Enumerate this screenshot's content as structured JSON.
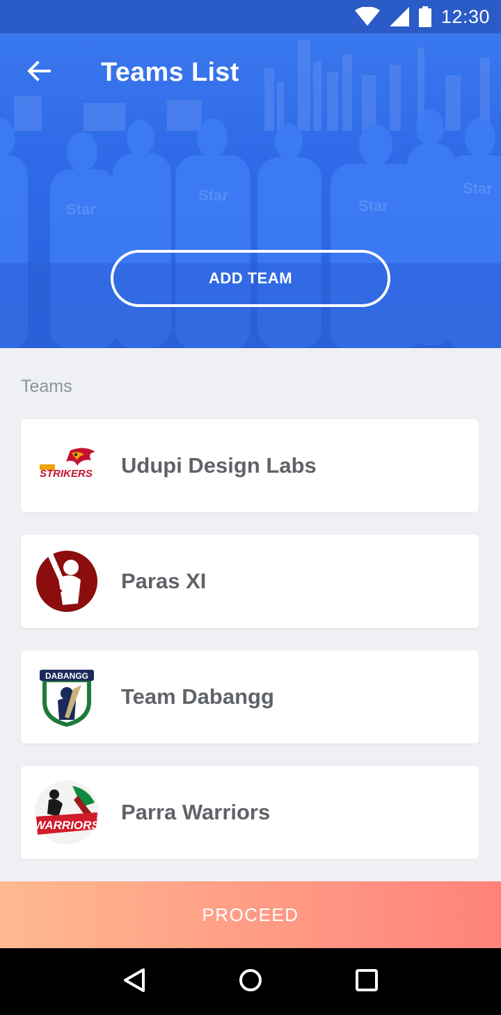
{
  "status_bar": {
    "time": "12:30",
    "icons": [
      "wifi-icon",
      "signal-icon",
      "battery-icon"
    ]
  },
  "header": {
    "title": "Teams List",
    "back_icon": "arrow-left-icon"
  },
  "hero": {
    "add_team_label": "ADD TEAM"
  },
  "teams": {
    "section_label": "Teams",
    "items": [
      {
        "name": "Udupi Design Labs",
        "logo": "udl-strikers-logo",
        "logo_text": "STRIKERS"
      },
      {
        "name": "Paras XI",
        "logo": "batsman-logo"
      },
      {
        "name": "Team Dabangg",
        "logo": "team-dabangg-logo",
        "logo_text": "DABANGG"
      },
      {
        "name": "Parra Warriors",
        "logo": "parra-warriors-logo",
        "logo_text": "WARRIORS"
      }
    ]
  },
  "footer": {
    "proceed_label": "PROCEED"
  },
  "nav": {
    "icons": [
      "back-triangle-icon",
      "home-circle-icon",
      "recents-square-icon"
    ]
  },
  "colors": {
    "accent_blue": "#2f6ae8",
    "status_bar": "#2a5bc7",
    "proceed_start": "#ffb98f",
    "proceed_end": "#ff827a"
  }
}
